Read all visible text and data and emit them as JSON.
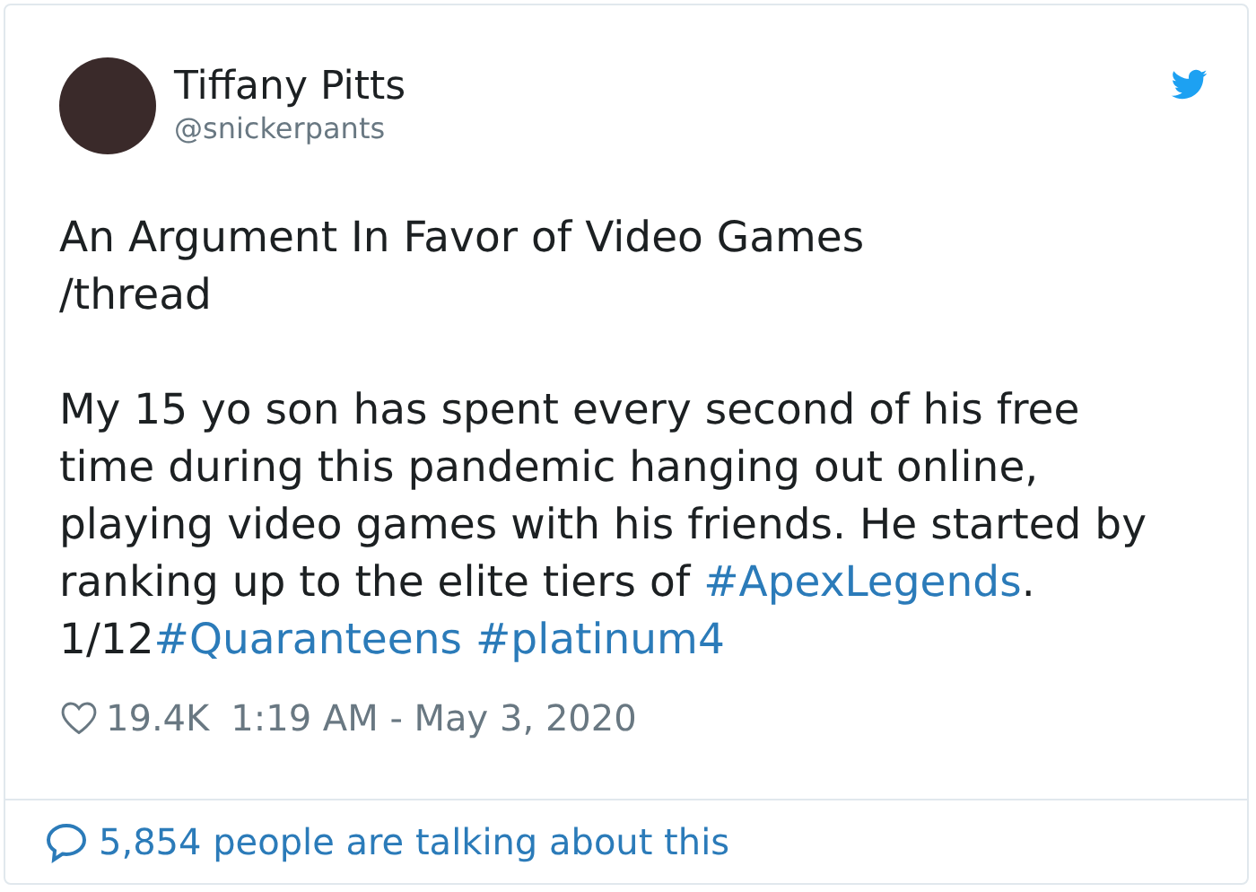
{
  "author": {
    "name": "Tiffany Pitts",
    "handle": "@snickerpants"
  },
  "paragraphs": [
    {
      "kind": "lines",
      "lines": [
        "An Argument In Favor of Video Games",
        "/thread"
      ]
    },
    {
      "kind": "segments",
      "segments": [
        {
          "kind": "text",
          "text": "My 15 yo son has spent every second of his free time during this pandemic hanging out online, playing video games with his friends. He started by ranking up to the elite tiers of "
        },
        {
          "kind": "hashtag",
          "text": "#ApexLegends"
        },
        {
          "kind": "text",
          "text": ". 1/12"
        },
        {
          "kind": "hashtag",
          "text": "#Quaranteens"
        },
        {
          "kind": "hashtag",
          "text": "#platinum4",
          "space_before": true
        }
      ]
    }
  ],
  "likes": "19.4K",
  "timestamp": "1:19 AM - May 3, 2020",
  "footer": {
    "text": "5,854 people are talking about this"
  }
}
